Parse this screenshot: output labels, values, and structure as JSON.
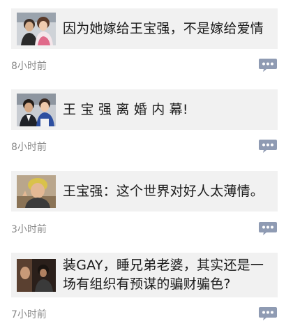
{
  "feed": {
    "items": [
      {
        "title": "因为她嫁给王宝强，不是嫁给爱情",
        "time": "8小时前",
        "thumbnail": "couple-photo",
        "action_icon": "comment-icon"
      },
      {
        "title": "王 宝 强 离 婚 内 幕!",
        "time": "8小时前",
        "thumbnail": "couple-photo",
        "action_icon": "comment-icon"
      },
      {
        "title": "王宝强：这个世界对好人太薄情。",
        "time": "3小时前",
        "thumbnail": "portrait-photo",
        "action_icon": "comment-icon"
      },
      {
        "title": "装GAY，睡兄弟老婆，其实还是一场有组织有预谋的骗财骗色?",
        "time": "7小时前",
        "thumbnail": "dark-scene-photo",
        "action_icon": "comment-icon"
      }
    ]
  },
  "colors": {
    "card_background": "#f1f1f1",
    "title_text": "#1a1a1a",
    "time_text": "#8a8a8a",
    "icon": "#8f9bb3"
  }
}
